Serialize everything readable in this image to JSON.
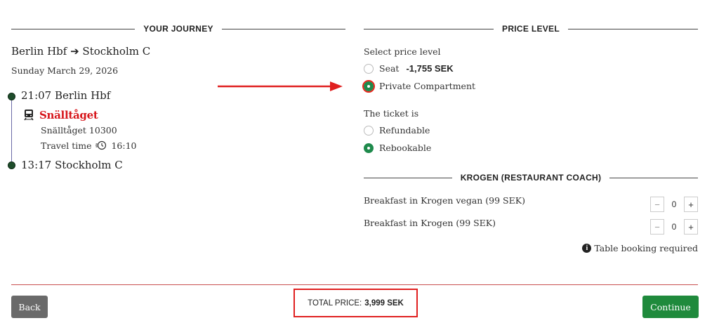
{
  "journey": {
    "heading": "YOUR JOURNEY",
    "route": "Berlin Hbf ➔ Stockholm C",
    "date": "Sunday March 29, 2026",
    "departure": "21:07 Berlin Hbf",
    "arrival": "13:17 Stockholm C",
    "operator": "Snälltåget",
    "train_number": "Snälltåget 10300",
    "travel_time_label": "Travel time",
    "travel_time_value": "16:10"
  },
  "price_level": {
    "heading": "PRICE LEVEL",
    "select_label": "Select price level",
    "options": [
      {
        "label": "Seat",
        "price": "-1,755 SEK",
        "selected": false
      },
      {
        "label": "Private Compartment",
        "selected": true
      }
    ],
    "ticket_is_label": "The ticket is",
    "ticket_options": [
      {
        "label": "Refundable",
        "selected": false
      },
      {
        "label": "Rebookable",
        "selected": true
      }
    ]
  },
  "krogen": {
    "heading": "KROGEN (RESTAURANT COACH)",
    "items": [
      {
        "label": "Breakfast in Krogen vegan (99 SEK)",
        "quantity": "0"
      },
      {
        "label": "Breakfast in Krogen (99 SEK)",
        "quantity": "0"
      }
    ],
    "minus_symbol": "−",
    "plus_symbol": "+",
    "note": "Table booking required"
  },
  "footer": {
    "back_label": "Back",
    "total_label": "TOTAL PRICE:",
    "total_amount": "3,999 SEK",
    "continue_label": "Continue"
  },
  "colors": {
    "accent_green": "#1f8a3c",
    "operator_red": "#d7161b",
    "annotation_red": "#e02020"
  },
  "icons": {
    "train": "train-icon",
    "clock": "clock-icon",
    "info": "info-icon",
    "arrow": "annotation-arrow-icon"
  }
}
